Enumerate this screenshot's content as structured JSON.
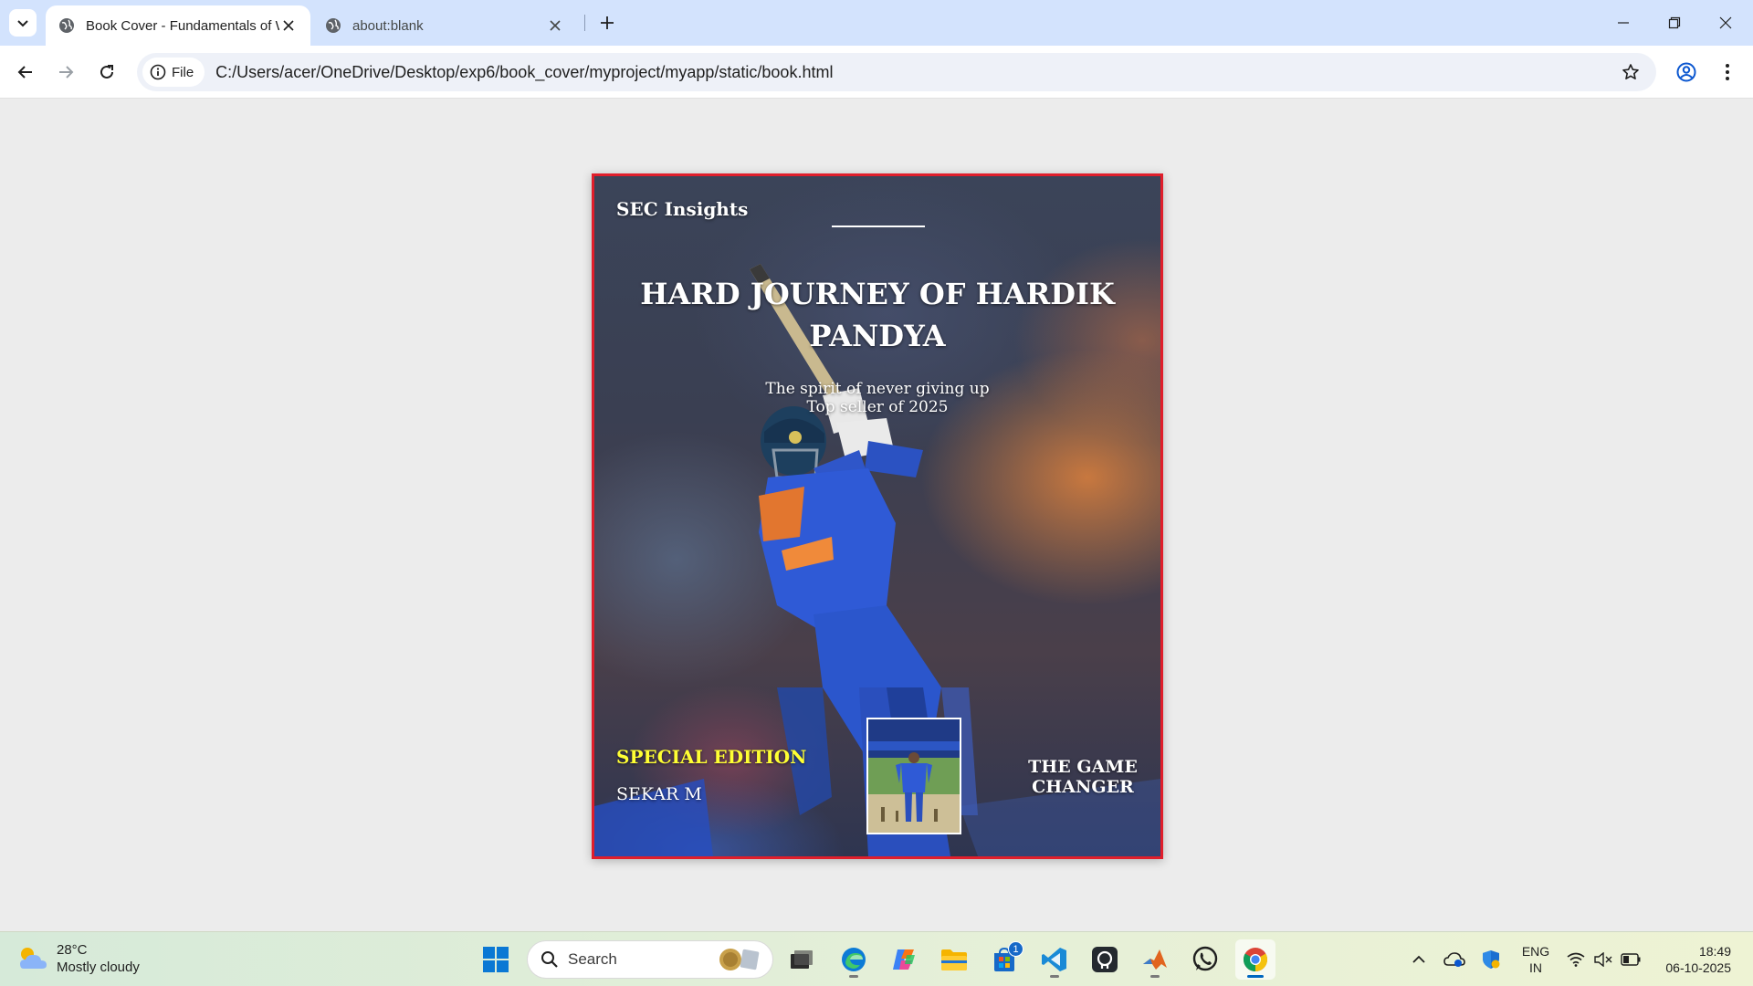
{
  "browser": {
    "tabs": [
      {
        "title": "Book Cover - Fundamentals of W",
        "active": true
      },
      {
        "title": "about:blank",
        "active": false
      }
    ],
    "site_chip_label": "File",
    "url": "C:/Users/acer/OneDrive/Desktop/exp6/book_cover/myproject/myapp/static/book.html"
  },
  "cover": {
    "brand": "SEC Insights",
    "title": "HARD JOURNEY OF HARDIK PANDYA",
    "subtitle_line1": "The spirit of never giving up",
    "subtitle_line2": "Top seller of 2025",
    "edition": "SPECIAL EDITION",
    "author": "SEKAR M",
    "tagline": "THE GAME CHANGER",
    "colors": {
      "border": "#e01e2b",
      "edition": "#ffff33"
    }
  },
  "taskbar": {
    "weather_temp": "28°C",
    "weather_desc": "Mostly cloudy",
    "search_label": "Search",
    "store_badge": "1",
    "lang_line1": "ENG",
    "lang_line2": "IN",
    "time": "18:49",
    "date": "06-10-2025",
    "apps": [
      "file-explorer-task-view",
      "edge",
      "copilot",
      "file-explorer",
      "microsoft-store",
      "vs-code",
      "github-desktop",
      "matlab",
      "whatsapp",
      "chrome"
    ]
  }
}
